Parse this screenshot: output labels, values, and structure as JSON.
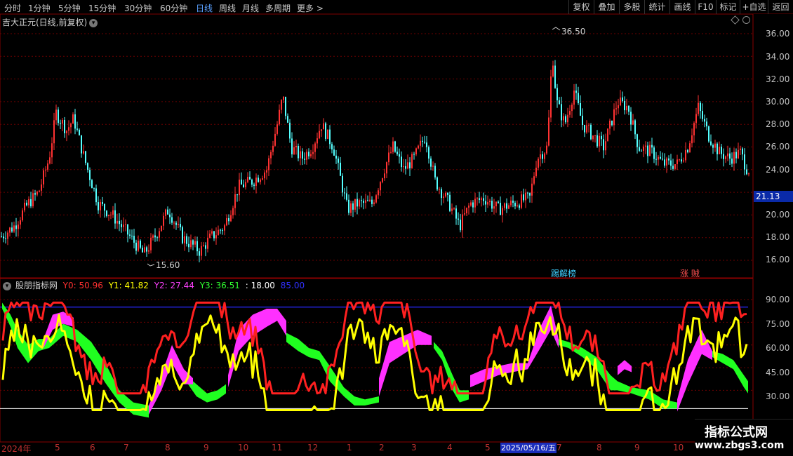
{
  "toolbar": {
    "periods": [
      "分时",
      "1分钟",
      "5分钟",
      "15分钟",
      "30分钟",
      "60分钟",
      "日线",
      "周线",
      "月线",
      "多周期",
      "更多 >"
    ],
    "active_period": "日线",
    "right_buttons": [
      "复权",
      "叠加",
      "多股",
      "统计",
      "画线",
      "F10",
      "标记",
      "+自选",
      "返回"
    ]
  },
  "main_chart": {
    "title": "吉大正元(日线,前复权)",
    "high_label": "36.50",
    "low_label": "15.60",
    "current_price": "21.13",
    "price_ticks": [
      "36.00",
      "34.00",
      "32.00",
      "30.00",
      "28.00",
      "26.00",
      "24.00",
      "20.00",
      "18.00",
      "16.00"
    ],
    "tag_left": "踢解榜",
    "tag_right": "涨 贼"
  },
  "indicator": {
    "name": "股朋指标网",
    "values": [
      {
        "label": "Y0: 50.96",
        "color": "#ff3030"
      },
      {
        "label": "Y1: 41.82",
        "color": "#ffff00"
      },
      {
        "label": "Y2: 27.44",
        "color": "#ff40ff"
      },
      {
        "label": "Y3: 36.51",
        "color": "#30ff30"
      },
      {
        "label": ": 18.00",
        "color": "#ffffff"
      },
      {
        "label": "85.00",
        "color": "#3030ff"
      }
    ],
    "ticks": [
      "90.00",
      "75.00",
      "60.00",
      "45.00",
      "30.00"
    ]
  },
  "date_axis": {
    "start_label": "2024年",
    "months": [
      "5",
      "6",
      "7",
      "8",
      "9",
      "10",
      "11",
      "12",
      "1",
      "2",
      "3",
      "4",
      "5",
      "7",
      "8",
      "9",
      "10"
    ],
    "cursor_date": "2025/05/16/五"
  },
  "watermark": {
    "line1": "指标公式网",
    "line2": "www.zbgs3.com"
  },
  "colors": {
    "up": "#ff3232",
    "down": "#54ffff",
    "grid": "#6b0000",
    "y0": "#ff2020",
    "y1": "#ffff00",
    "y2": "#ff30ff",
    "y3": "#20ff20"
  }
}
